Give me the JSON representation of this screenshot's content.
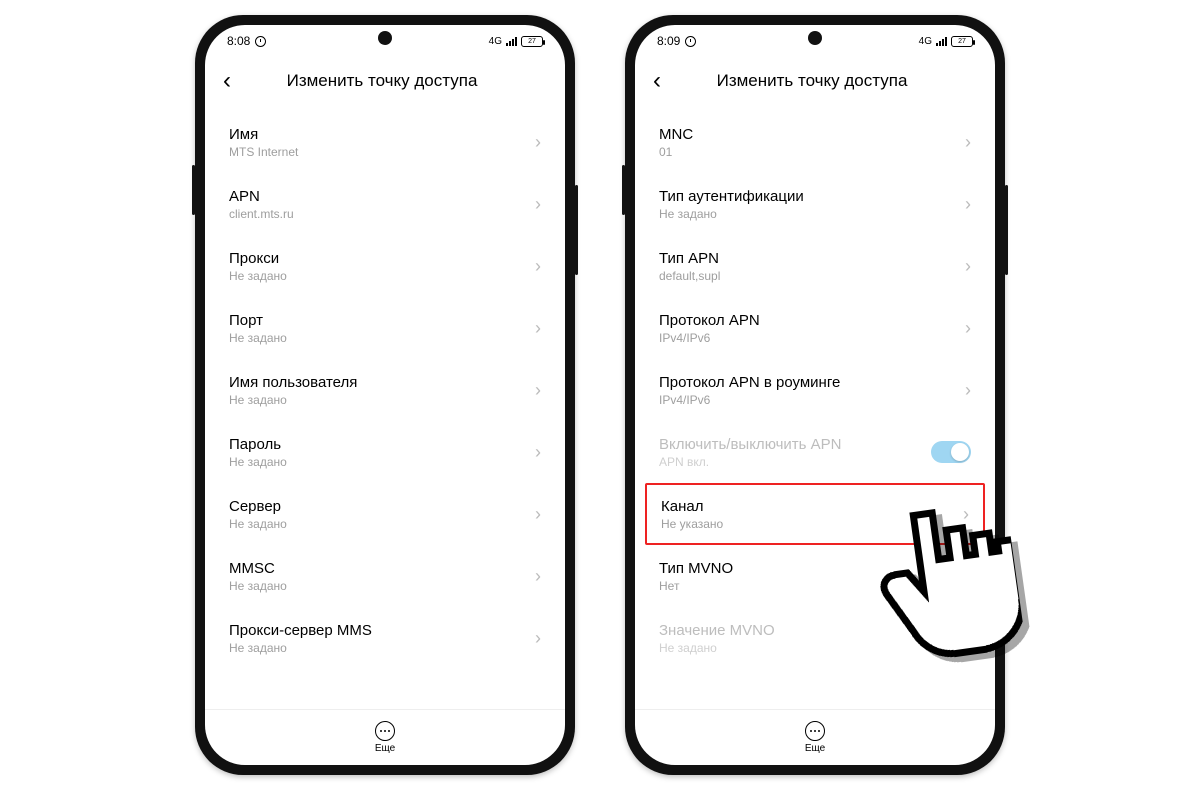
{
  "phone1": {
    "status": {
      "time": "8:08",
      "net": "4G",
      "battery": "27"
    },
    "title": "Изменить точку доступа",
    "rows": [
      {
        "label": "Имя",
        "sub": "MTS Internet"
      },
      {
        "label": "APN",
        "sub": "client.mts.ru"
      },
      {
        "label": "Прокси",
        "sub": "Не задано"
      },
      {
        "label": "Порт",
        "sub": "Не задано"
      },
      {
        "label": "Имя пользователя",
        "sub": "Не задано"
      },
      {
        "label": "Пароль",
        "sub": "Не задано"
      },
      {
        "label": "Сервер",
        "sub": "Не задано"
      },
      {
        "label": "MMSC",
        "sub": "Не задано"
      },
      {
        "label": "Прокси-сервер MMS",
        "sub": "Не задано"
      }
    ],
    "more": "Еще"
  },
  "phone2": {
    "status": {
      "time": "8:09",
      "net": "4G",
      "battery": "27"
    },
    "title": "Изменить точку доступа",
    "rows": [
      {
        "label": "MNC",
        "sub": "01"
      },
      {
        "label": "Тип аутентификации",
        "sub": "Не задано"
      },
      {
        "label": "Тип APN",
        "sub": "default,supl"
      },
      {
        "label": "Протокол APN",
        "sub": "IPv4/IPv6"
      },
      {
        "label": "Протокол APN в роуминге",
        "sub": "IPv4/IPv6"
      },
      {
        "label": "Включить/выключить APN",
        "sub": "APN вкл.",
        "toggle": true,
        "disabled": true
      },
      {
        "label": "Канал",
        "sub": "Не указано",
        "highlight": true
      },
      {
        "label": "Тип MVNO",
        "sub": "Нет"
      },
      {
        "label": "Значение MVNO",
        "sub": "Не задано",
        "disabled": true
      }
    ],
    "more": "Еще"
  }
}
